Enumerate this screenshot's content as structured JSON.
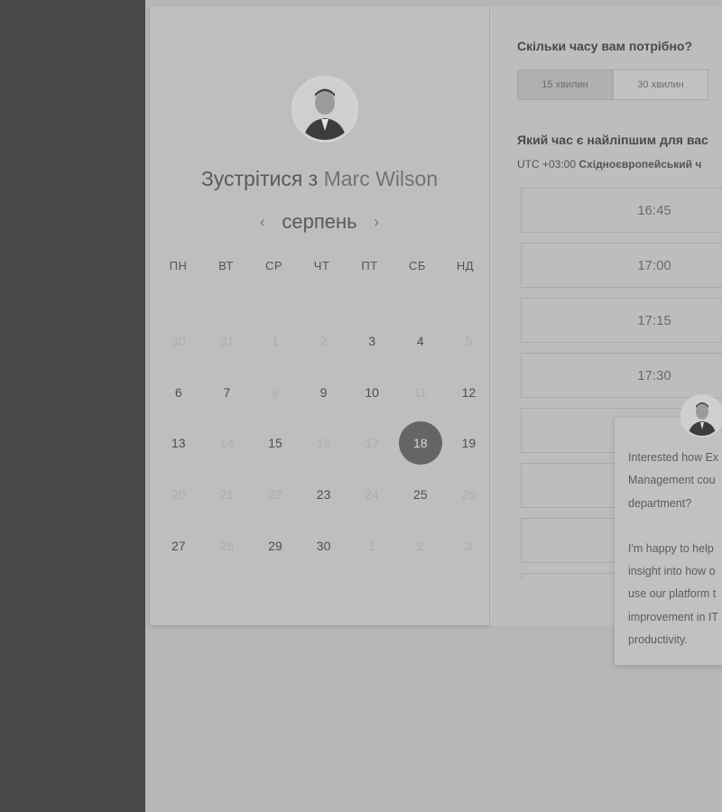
{
  "calendar": {
    "title_prefix": "Зустрітися з",
    "host_name": "Marc Wilson",
    "month": "серпень",
    "prev_arrow": "‹",
    "next_arrow": "›",
    "weekdays": [
      "ПН",
      "ВТ",
      "СР",
      "ЧТ",
      "ПТ",
      "СБ",
      "НД"
    ],
    "weeks": [
      [
        {
          "d": "30",
          "available": false
        },
        {
          "d": "31",
          "available": false
        },
        {
          "d": "1",
          "available": false
        },
        {
          "d": "2",
          "available": false
        },
        {
          "d": "3",
          "available": true
        },
        {
          "d": "4",
          "available": true
        },
        {
          "d": "5",
          "available": false
        }
      ],
      [
        {
          "d": "6",
          "available": true
        },
        {
          "d": "7",
          "available": true
        },
        {
          "d": "8",
          "available": false
        },
        {
          "d": "9",
          "available": true
        },
        {
          "d": "10",
          "available": true
        },
        {
          "d": "11",
          "available": false
        },
        {
          "d": "12",
          "available": true
        }
      ],
      [
        {
          "d": "13",
          "available": true
        },
        {
          "d": "14",
          "available": false
        },
        {
          "d": "15",
          "available": true
        },
        {
          "d": "16",
          "available": false
        },
        {
          "d": "17",
          "available": false
        },
        {
          "d": "18",
          "available": true,
          "selected": true
        },
        {
          "d": "19",
          "available": true
        }
      ],
      [
        {
          "d": "20",
          "available": false
        },
        {
          "d": "21",
          "available": false
        },
        {
          "d": "22",
          "available": false
        },
        {
          "d": "23",
          "available": true
        },
        {
          "d": "24",
          "available": false
        },
        {
          "d": "25",
          "available": true
        },
        {
          "d": "26",
          "available": false
        }
      ],
      [
        {
          "d": "27",
          "available": true
        },
        {
          "d": "28",
          "available": false
        },
        {
          "d": "29",
          "available": true
        },
        {
          "d": "30",
          "available": true
        },
        {
          "d": "1",
          "available": false
        },
        {
          "d": "2",
          "available": false
        },
        {
          "d": "3",
          "available": false
        }
      ]
    ]
  },
  "booking": {
    "duration_question": "Скільки часу вам потрібно?",
    "durations": [
      {
        "label": "15 хвилин",
        "active": true
      },
      {
        "label": "30 хвилин",
        "active": false
      }
    ],
    "time_question": "Який час є найліпшим для вас",
    "tz_offset": "UTC +03:00",
    "tz_name": "Східноєвропейський ч",
    "slots": [
      "16:45",
      "17:00",
      "17:15",
      "17:30",
      "",
      "",
      "",
      ""
    ]
  },
  "chat": {
    "paragraph1": "Interested how Ex Management cou department?",
    "paragraph2": "I'm happy to help insight into how o use our platform t improvement in IT productivity.",
    "lines1": [
      "Interested how Ex",
      "Management cou",
      "department?"
    ],
    "lines2": [
      "I'm happy to help",
      "insight into how o",
      "use our platform t",
      "improvement in IT",
      "productivity."
    ]
  }
}
